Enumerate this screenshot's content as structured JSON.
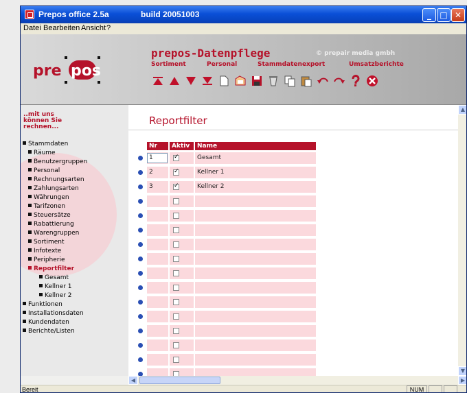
{
  "window": {
    "title": "Prepos office 2.5a",
    "build": "build 20051003",
    "minimize": "_",
    "maximize": "□",
    "close": "✕"
  },
  "menu": [
    "Datei",
    "Bearbeiten",
    "Ansicht",
    "?"
  ],
  "banner": {
    "logo_left": "pre",
    "logo_right": "pos",
    "title": "prepos-Datenpflege",
    "copyright": "© prepair media gmbh",
    "nav": [
      "Sortiment",
      "Personal",
      "Stammdatenexport",
      "Umsatzberichte"
    ],
    "toolbar_icons": [
      "first-icon",
      "previous-icon",
      "next-icon",
      "last-icon",
      "new-icon",
      "open-icon",
      "save-icon",
      "delete-icon",
      "copy-icon",
      "paste-icon",
      "undo-icon",
      "redo-icon",
      "help-icon",
      "exit-icon"
    ]
  },
  "sidebar": {
    "tagline": [
      "..mit uns",
      "können Sie",
      "rechnen..."
    ],
    "tree": [
      {
        "label": "Stammdaten",
        "level": 0
      },
      {
        "label": "Räume",
        "level": 1
      },
      {
        "label": "Benutzergruppen",
        "level": 1
      },
      {
        "label": "Personal",
        "level": 1
      },
      {
        "label": "Rechnungsarten",
        "level": 1
      },
      {
        "label": "Zahlungsarten",
        "level": 1
      },
      {
        "label": "Währungen",
        "level": 1
      },
      {
        "label": "Tarifzonen",
        "level": 1
      },
      {
        "label": "Steuersätze",
        "level": 1
      },
      {
        "label": "Rabattierung",
        "level": 1
      },
      {
        "label": "Warengruppen",
        "level": 1
      },
      {
        "label": "Sortiment",
        "level": 1
      },
      {
        "label": "Infotexte",
        "level": 1
      },
      {
        "label": "Peripherie",
        "level": 1
      },
      {
        "label": "Reportfilter",
        "level": 1,
        "active": true
      },
      {
        "label": "Gesamt",
        "level": 2
      },
      {
        "label": "Kellner 1",
        "level": 2
      },
      {
        "label": "Kellner 2",
        "level": 2
      },
      {
        "label": "Funktionen",
        "level": 0
      },
      {
        "label": "Installationsdaten",
        "level": 0
      },
      {
        "label": "Kundendaten",
        "level": 0
      },
      {
        "label": "Berichte/Listen",
        "level": 0
      }
    ]
  },
  "content": {
    "title": "Reportfilter",
    "columns": [
      "Nr",
      "Aktiv",
      "Name"
    ],
    "rows": [
      {
        "nr": "1",
        "aktiv": true,
        "name": "Gesamt"
      },
      {
        "nr": "2",
        "aktiv": true,
        "name": "Kellner 1"
      },
      {
        "nr": "3",
        "aktiv": true,
        "name": "Kellner 2"
      },
      {
        "nr": "",
        "aktiv": false,
        "name": ""
      },
      {
        "nr": "",
        "aktiv": false,
        "name": ""
      },
      {
        "nr": "",
        "aktiv": false,
        "name": ""
      },
      {
        "nr": "",
        "aktiv": false,
        "name": ""
      },
      {
        "nr": "",
        "aktiv": false,
        "name": ""
      },
      {
        "nr": "",
        "aktiv": false,
        "name": ""
      },
      {
        "nr": "",
        "aktiv": false,
        "name": ""
      },
      {
        "nr": "",
        "aktiv": false,
        "name": ""
      },
      {
        "nr": "",
        "aktiv": false,
        "name": ""
      },
      {
        "nr": "",
        "aktiv": false,
        "name": ""
      },
      {
        "nr": "",
        "aktiv": false,
        "name": ""
      },
      {
        "nr": "",
        "aktiv": false,
        "name": ""
      },
      {
        "nr": "",
        "aktiv": false,
        "name": ""
      }
    ]
  },
  "scroll": {
    "up": "▲",
    "down": "▼",
    "left": "◀",
    "right": "▶"
  },
  "status": {
    "text": "Bereit",
    "num": "NUM"
  }
}
